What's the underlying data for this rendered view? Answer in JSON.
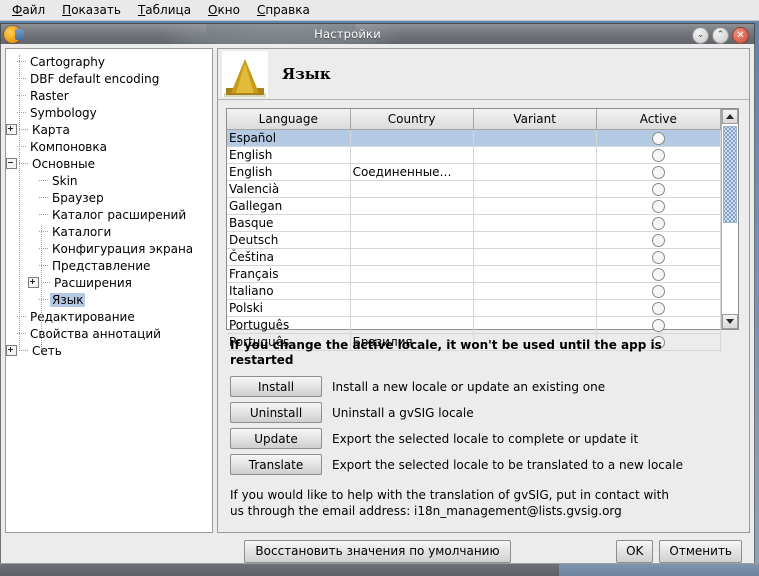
{
  "menubar": {
    "items": [
      {
        "mnemonic": "Ф",
        "rest": "айл"
      },
      {
        "mnemonic": "П",
        "rest": "оказать"
      },
      {
        "mnemonic": "Т",
        "rest": "аблица"
      },
      {
        "mnemonic": "О",
        "rest": "кно"
      },
      {
        "mnemonic": "С",
        "rest": "правка"
      }
    ]
  },
  "window": {
    "title": "Настройки",
    "icon": "gvsig-globe-icon",
    "controls": {
      "minimize": "⌄",
      "maximize": "⌃",
      "close": "✕"
    }
  },
  "tree": {
    "items": [
      {
        "label": "Cartography",
        "depth": 1,
        "toggle": "none"
      },
      {
        "label": "DBF default encoding",
        "depth": 1,
        "toggle": "none"
      },
      {
        "label": "Raster",
        "depth": 1,
        "toggle": "none"
      },
      {
        "label": "Symbology",
        "depth": 1,
        "toggle": "none"
      },
      {
        "label": "Карта",
        "depth": 1,
        "toggle": "plus"
      },
      {
        "label": "Компоновка",
        "depth": 1,
        "toggle": "none"
      },
      {
        "label": "Основные",
        "depth": 1,
        "toggle": "minus"
      },
      {
        "label": "Skin",
        "depth": 2,
        "toggle": "none"
      },
      {
        "label": "Браузер",
        "depth": 2,
        "toggle": "none"
      },
      {
        "label": "Каталог расширений",
        "depth": 2,
        "toggle": "none"
      },
      {
        "label": "Каталоги",
        "depth": 2,
        "toggle": "none"
      },
      {
        "label": "Конфигурация экрана",
        "depth": 2,
        "toggle": "none"
      },
      {
        "label": "Представление",
        "depth": 2,
        "toggle": "none"
      },
      {
        "label": "Расширения",
        "depth": 2,
        "toggle": "plus"
      },
      {
        "label": "Язык",
        "depth": 2,
        "toggle": "none",
        "selected": true
      },
      {
        "label": "Редактирование",
        "depth": 1,
        "toggle": "none"
      },
      {
        "label": "Свойства аннотаций",
        "depth": 1,
        "toggle": "none"
      },
      {
        "label": "Сеть",
        "depth": 1,
        "toggle": "plus"
      }
    ]
  },
  "panel": {
    "title": "Язык",
    "icon": "babel-tower-icon"
  },
  "table": {
    "columns": [
      "Language",
      "Country",
      "Variant",
      "Active"
    ],
    "rows": [
      {
        "language": "Español",
        "country": "",
        "variant": "",
        "active": false,
        "selected": true
      },
      {
        "language": "English",
        "country": "",
        "variant": "",
        "active": false
      },
      {
        "language": "English",
        "country": "Соединенные…",
        "variant": "",
        "active": false
      },
      {
        "language": "Valencià",
        "country": "",
        "variant": "",
        "active": false
      },
      {
        "language": "Gallegan",
        "country": "",
        "variant": "",
        "active": false
      },
      {
        "language": "Basque",
        "country": "",
        "variant": "",
        "active": false
      },
      {
        "language": "Deutsch",
        "country": "",
        "variant": "",
        "active": false
      },
      {
        "language": "Čeština",
        "country": "",
        "variant": "",
        "active": false
      },
      {
        "language": "Français",
        "country": "",
        "variant": "",
        "active": false
      },
      {
        "language": "Italiano",
        "country": "",
        "variant": "",
        "active": false
      },
      {
        "language": "Polski",
        "country": "",
        "variant": "",
        "active": false
      },
      {
        "language": "Português",
        "country": "",
        "variant": "",
        "active": false
      },
      {
        "language": "Português",
        "country": "Бразилия",
        "variant": "",
        "active": false
      }
    ]
  },
  "notes": {
    "warning": "If you change the active locale, it won't be used until the app is restarted",
    "contact": "If you would like to help with the translation of gvSIG, put in contact with us through the email address: i18n_management@lists.gvsig.org"
  },
  "actions": [
    {
      "label": "Install",
      "description": "Install a new locale or update an existing one"
    },
    {
      "label": "Uninstall",
      "description": "Uninstall a gvSIG locale"
    },
    {
      "label": "Update",
      "description": "Export the selected locale to complete or update it"
    },
    {
      "label": "Translate",
      "description": "Export the selected locale to be translated to a new locale"
    }
  ],
  "footer": {
    "restore_defaults": "Восстановить значения по умолчанию",
    "ok": "OK",
    "cancel": "Отменить"
  },
  "colors": {
    "selection": "#b4c9e4",
    "titlebar": "#72767c",
    "close_button": "#cf4b34",
    "panel_bg": "#ececec"
  }
}
